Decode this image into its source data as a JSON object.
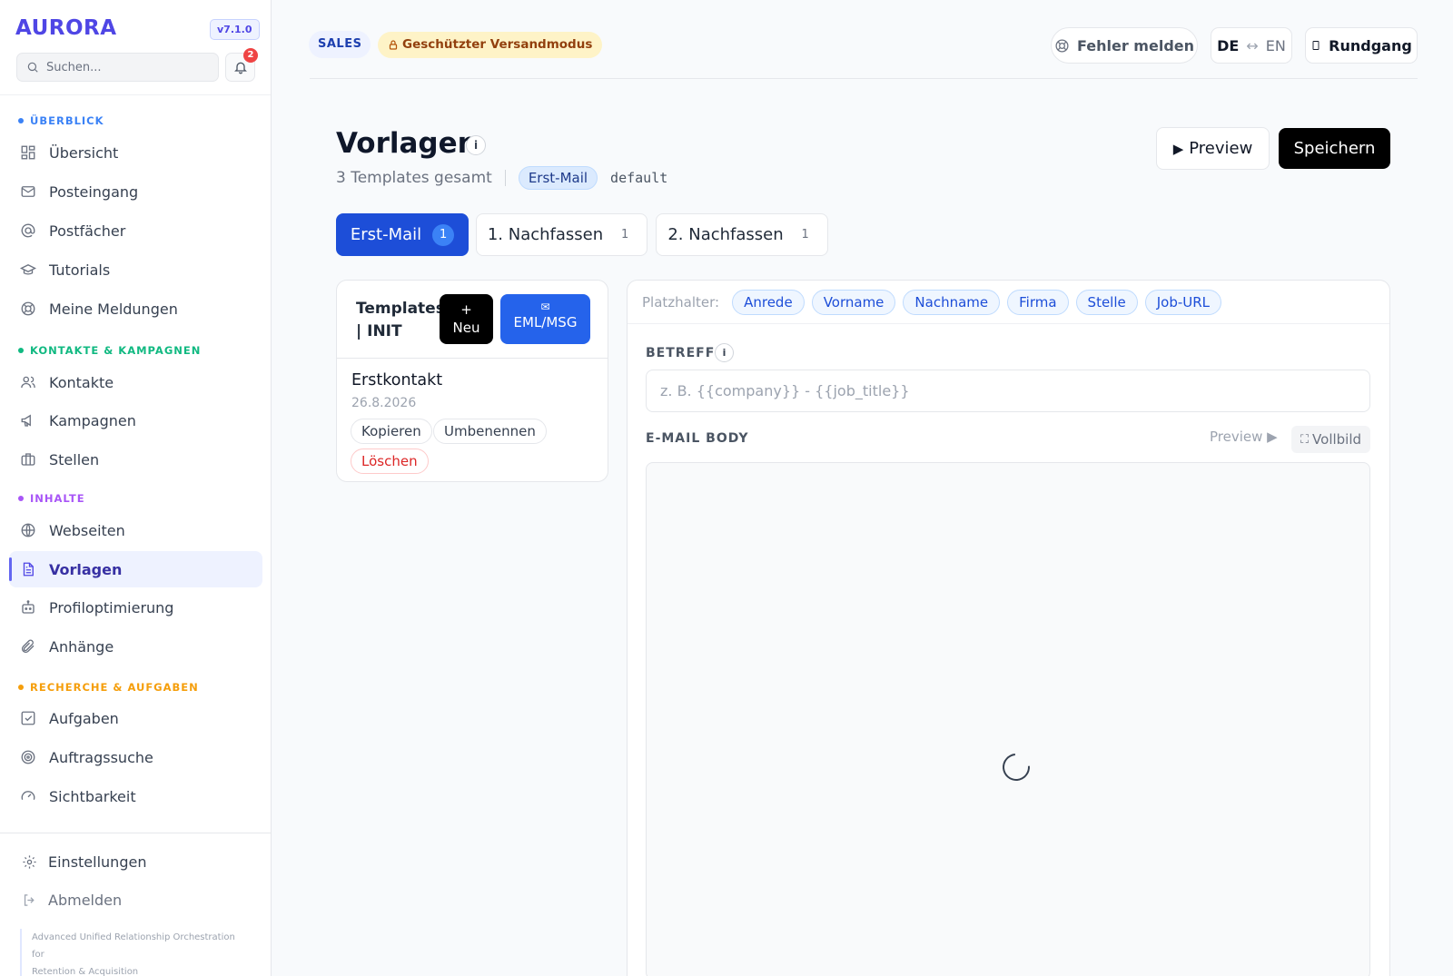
{
  "app": {
    "brand": "AURORA",
    "version": "v7.1.0",
    "tagline_lines": [
      "Advanced Unified Relationship Orchestration for",
      "Retention & Acquisition"
    ],
    "accent": "#4f46e5"
  },
  "sidebar": {
    "search_placeholder": "Suchen...",
    "notifications_count": "2",
    "sections": [
      {
        "label": "ÜBERBLICK",
        "color": "#3b82f6"
      },
      {
        "label": "KONTAKTE & KAMPAGNEN",
        "color": "#10b981"
      },
      {
        "label": "INHALTE",
        "color": "#a855f7"
      },
      {
        "label": "RECHERCHE & AUFGABEN",
        "color": "#f59e0b"
      }
    ],
    "items": [
      {
        "label": "Übersicht",
        "icon": "grid-icon"
      },
      {
        "label": "Posteingang",
        "icon": "mail-icon"
      },
      {
        "label": "Postfächer",
        "icon": "at-icon"
      },
      {
        "label": "Tutorials",
        "icon": "graduation-cap-icon"
      },
      {
        "label": "Meine Meldungen",
        "icon": "lifebuoy-icon"
      },
      {
        "label": "Kontakte",
        "icon": "users-icon"
      },
      {
        "label": "Kampagnen",
        "icon": "megaphone-icon"
      },
      {
        "label": "Stellen",
        "icon": "briefcase-icon"
      },
      {
        "label": "Webseiten",
        "icon": "globe-icon"
      },
      {
        "label": "Vorlagen",
        "icon": "file-text-icon",
        "active": true
      },
      {
        "label": "Profiloptimierung",
        "icon": "bot-icon"
      },
      {
        "label": "Anhänge",
        "icon": "paperclip-icon"
      },
      {
        "label": "Aufgaben",
        "icon": "check-square-icon"
      },
      {
        "label": "Auftragssuche",
        "icon": "target-icon"
      },
      {
        "label": "Sichtbarkeit",
        "icon": "gauge-icon"
      }
    ],
    "footer": {
      "settings": "Einstellungen",
      "logout": "Abmelden"
    }
  },
  "topbar": {
    "badge_sales": "SALES",
    "badge_protected": "Geschützter Versandmodus",
    "report_bug": "Fehler melden",
    "lang_de": "DE",
    "lang_arrow": "↔",
    "lang_en": "EN",
    "tour": "Rundgang"
  },
  "page": {
    "title": "Vorlagen",
    "info": "i",
    "count_text": "3 Templates gesamt",
    "active_type": "Erst-Mail",
    "variant": "default",
    "preview_button": "Preview",
    "save_button": "Speichern"
  },
  "tabs": [
    {
      "label": "Erst-Mail",
      "count": "1",
      "active": true
    },
    {
      "label": "1. Nachfassen",
      "count": "1"
    },
    {
      "label": "2. Nachfassen",
      "count": "1"
    }
  ],
  "template_list": {
    "title": "Templates | INIT",
    "new_button": "+ Neu",
    "import_button": "EML/MSG",
    "items": [
      {
        "name": "Erstkontakt",
        "date": "26.8.2026",
        "copy": "Kopieren",
        "rename": "Umbenennen",
        "delete": "Löschen"
      }
    ]
  },
  "editor": {
    "placeholders_label": "Platzhalter:",
    "placeholders": [
      "Anrede",
      "Vorname",
      "Nachname",
      "Firma",
      "Stelle",
      "Job-URL"
    ],
    "subject_label": "BETREFF",
    "subject_info": "i",
    "subject_placeholder": "z. B. {{company}} - {{job_title}}",
    "subject_value": "",
    "body_label": "E-MAIL BODY",
    "body_preview": "Preview ▶",
    "fullscreen": "Vollbild"
  }
}
